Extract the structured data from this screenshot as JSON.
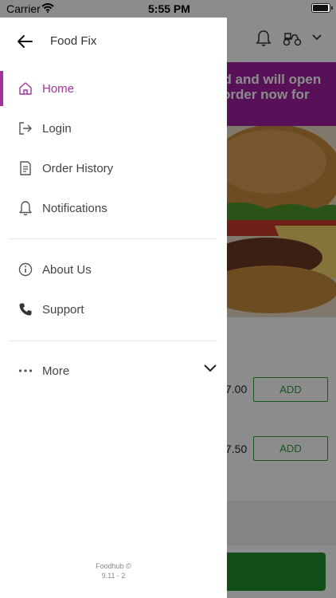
{
  "status_bar": {
    "carrier": "Carrier",
    "time": "5:55 PM"
  },
  "drawer": {
    "title": "Food Fix",
    "items": [
      {
        "label": "Home",
        "icon": "home-icon",
        "active": true
      },
      {
        "label": "Login",
        "icon": "login-icon",
        "active": false
      },
      {
        "label": "Order History",
        "icon": "order-history-icon",
        "active": false
      },
      {
        "label": "Notifications",
        "icon": "bell-icon",
        "active": false
      },
      {
        "label": "About Us",
        "icon": "info-icon",
        "active": false
      },
      {
        "label": "Support",
        "icon": "phone-icon",
        "active": false
      },
      {
        "label": "More",
        "icon": "more-icon",
        "active": false
      }
    ],
    "footer_line1": "Foodhub ©",
    "footer_line2": "9.11 - 2"
  },
  "background": {
    "banner_line1": "ed and will open",
    "banner_line2": "order now for",
    "products": [
      {
        "price": "7.00",
        "add_label": "ADD"
      },
      {
        "price": "7.50",
        "add_label": "ADD"
      }
    ]
  },
  "colors": {
    "accent": "#a3329f",
    "banner": "#a020a0",
    "green": "#2e9d3b"
  }
}
